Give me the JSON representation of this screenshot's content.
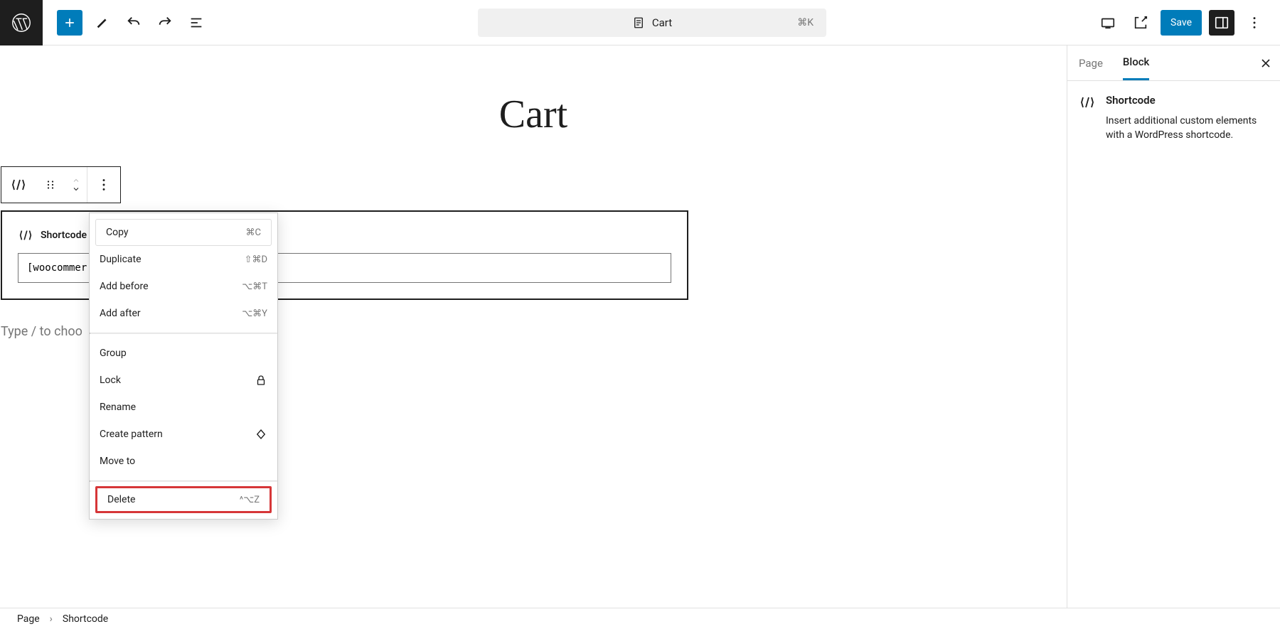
{
  "header": {
    "doc_title": "Cart",
    "doc_shortcut": "⌘K",
    "save_label": "Save"
  },
  "page_title": "Cart",
  "block": {
    "toolbar_icon": "shortcode",
    "label": "Shortcode",
    "value": "[woocommer"
  },
  "block_placeholder": "Type / to choo",
  "context_menu": {
    "items_group1": [
      {
        "label": "Copy",
        "shortcut": "⌘C"
      },
      {
        "label": "Duplicate",
        "shortcut": "⇧⌘D"
      },
      {
        "label": "Add before",
        "shortcut": "⌥⌘T"
      },
      {
        "label": "Add after",
        "shortcut": "⌥⌘Y"
      }
    ],
    "items_group2": [
      {
        "label": "Group",
        "shortcut": ""
      },
      {
        "label": "Lock",
        "icon": "lock"
      },
      {
        "label": "Rename",
        "shortcut": ""
      },
      {
        "label": "Create pattern",
        "icon": "pattern"
      },
      {
        "label": "Move to",
        "shortcut": ""
      }
    ],
    "delete": {
      "label": "Delete",
      "shortcut": "^⌥Z"
    }
  },
  "sidebar": {
    "tabs": {
      "page": "Page",
      "block": "Block"
    },
    "block_info": {
      "title": "Shortcode",
      "description": "Insert additional custom elements with a WordPress shortcode."
    }
  },
  "breadcrumbs": {
    "root": "Page",
    "current": "Shortcode"
  }
}
